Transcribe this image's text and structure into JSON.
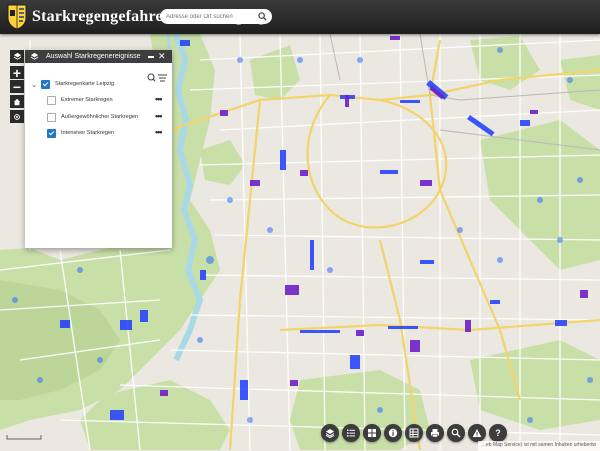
{
  "app": {
    "title": "Starkregengefahrenkarte Leipzig",
    "search_placeholder": "Adresse oder Ort suchen"
  },
  "panel": {
    "title": "Auswahl Starkregenereignisse",
    "items": [
      {
        "label": "Starkregenkarte Leipzig",
        "checked": true
      },
      {
        "label": "Extremer Starkregen",
        "checked": false
      },
      {
        "label": "Außergewöhnlicher Starkregen",
        "checked": false
      },
      {
        "label": "Intensiver Starkregen",
        "checked": true
      }
    ]
  },
  "map_controls": {
    "zoom_in": "+",
    "zoom_out": "−"
  },
  "bottom_toolbar": [
    {
      "icon": "layers-icon"
    },
    {
      "icon": "list-icon"
    },
    {
      "icon": "basemap-icon"
    },
    {
      "icon": "info-icon"
    },
    {
      "icon": "table-icon"
    },
    {
      "icon": "print-icon"
    },
    {
      "icon": "measure-icon"
    },
    {
      "icon": "warning-icon"
    },
    {
      "icon": "help-icon",
      "label": "?"
    }
  ],
  "attribution": "...eb Map Service) ist mit samen Inhalten urhebertw",
  "colors": {
    "header": "#2a2a2a",
    "accent": "#2276c4",
    "river": "#a9d9e6",
    "park": "#c9dfa8",
    "flood_blue": "#1e3cff",
    "flood_purple": "#6e1fc8"
  }
}
